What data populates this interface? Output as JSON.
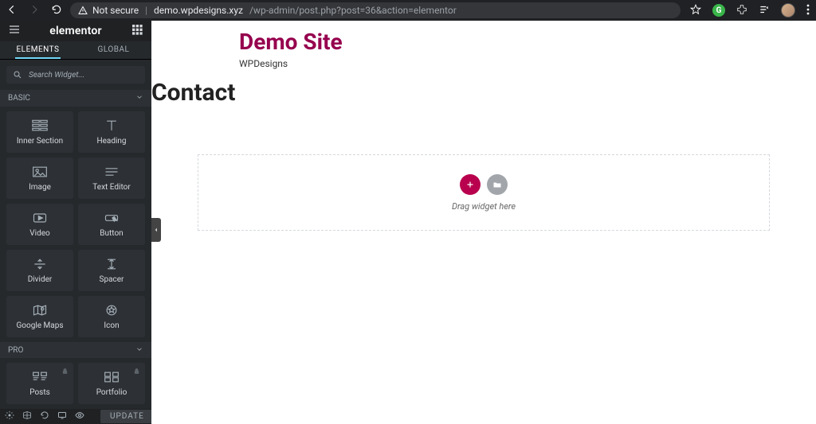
{
  "browser": {
    "insecure_label": "Not secure",
    "url_host": "demo.wpdesigns.xyz",
    "url_path": "/wp-admin/post.php?post=36&action=elementor"
  },
  "sidebar": {
    "logo": "elementor",
    "tabs": {
      "elements": "ELEMENTS",
      "global": "GLOBAL"
    },
    "search_placeholder": "Search Widget...",
    "categories": {
      "basic": {
        "label": "BASIC",
        "widgets": [
          {
            "name": "inner-section",
            "label": "Inner Section"
          },
          {
            "name": "heading",
            "label": "Heading"
          },
          {
            "name": "image",
            "label": "Image"
          },
          {
            "name": "text-editor",
            "label": "Text Editor"
          },
          {
            "name": "video",
            "label": "Video"
          },
          {
            "name": "button",
            "label": "Button"
          },
          {
            "name": "divider",
            "label": "Divider"
          },
          {
            "name": "spacer",
            "label": "Spacer"
          },
          {
            "name": "google-maps",
            "label": "Google Maps"
          },
          {
            "name": "icon",
            "label": "Icon"
          }
        ]
      },
      "pro": {
        "label": "PRO",
        "widgets": [
          {
            "name": "posts",
            "label": "Posts"
          },
          {
            "name": "portfolio",
            "label": "Portfolio"
          }
        ]
      }
    },
    "footer": {
      "update_label": "UPDATE"
    }
  },
  "preview": {
    "site_title": "Demo Site",
    "site_subtitle": "WPDesigns",
    "page_title": "Contact",
    "drag_hint": "Drag widget here"
  }
}
